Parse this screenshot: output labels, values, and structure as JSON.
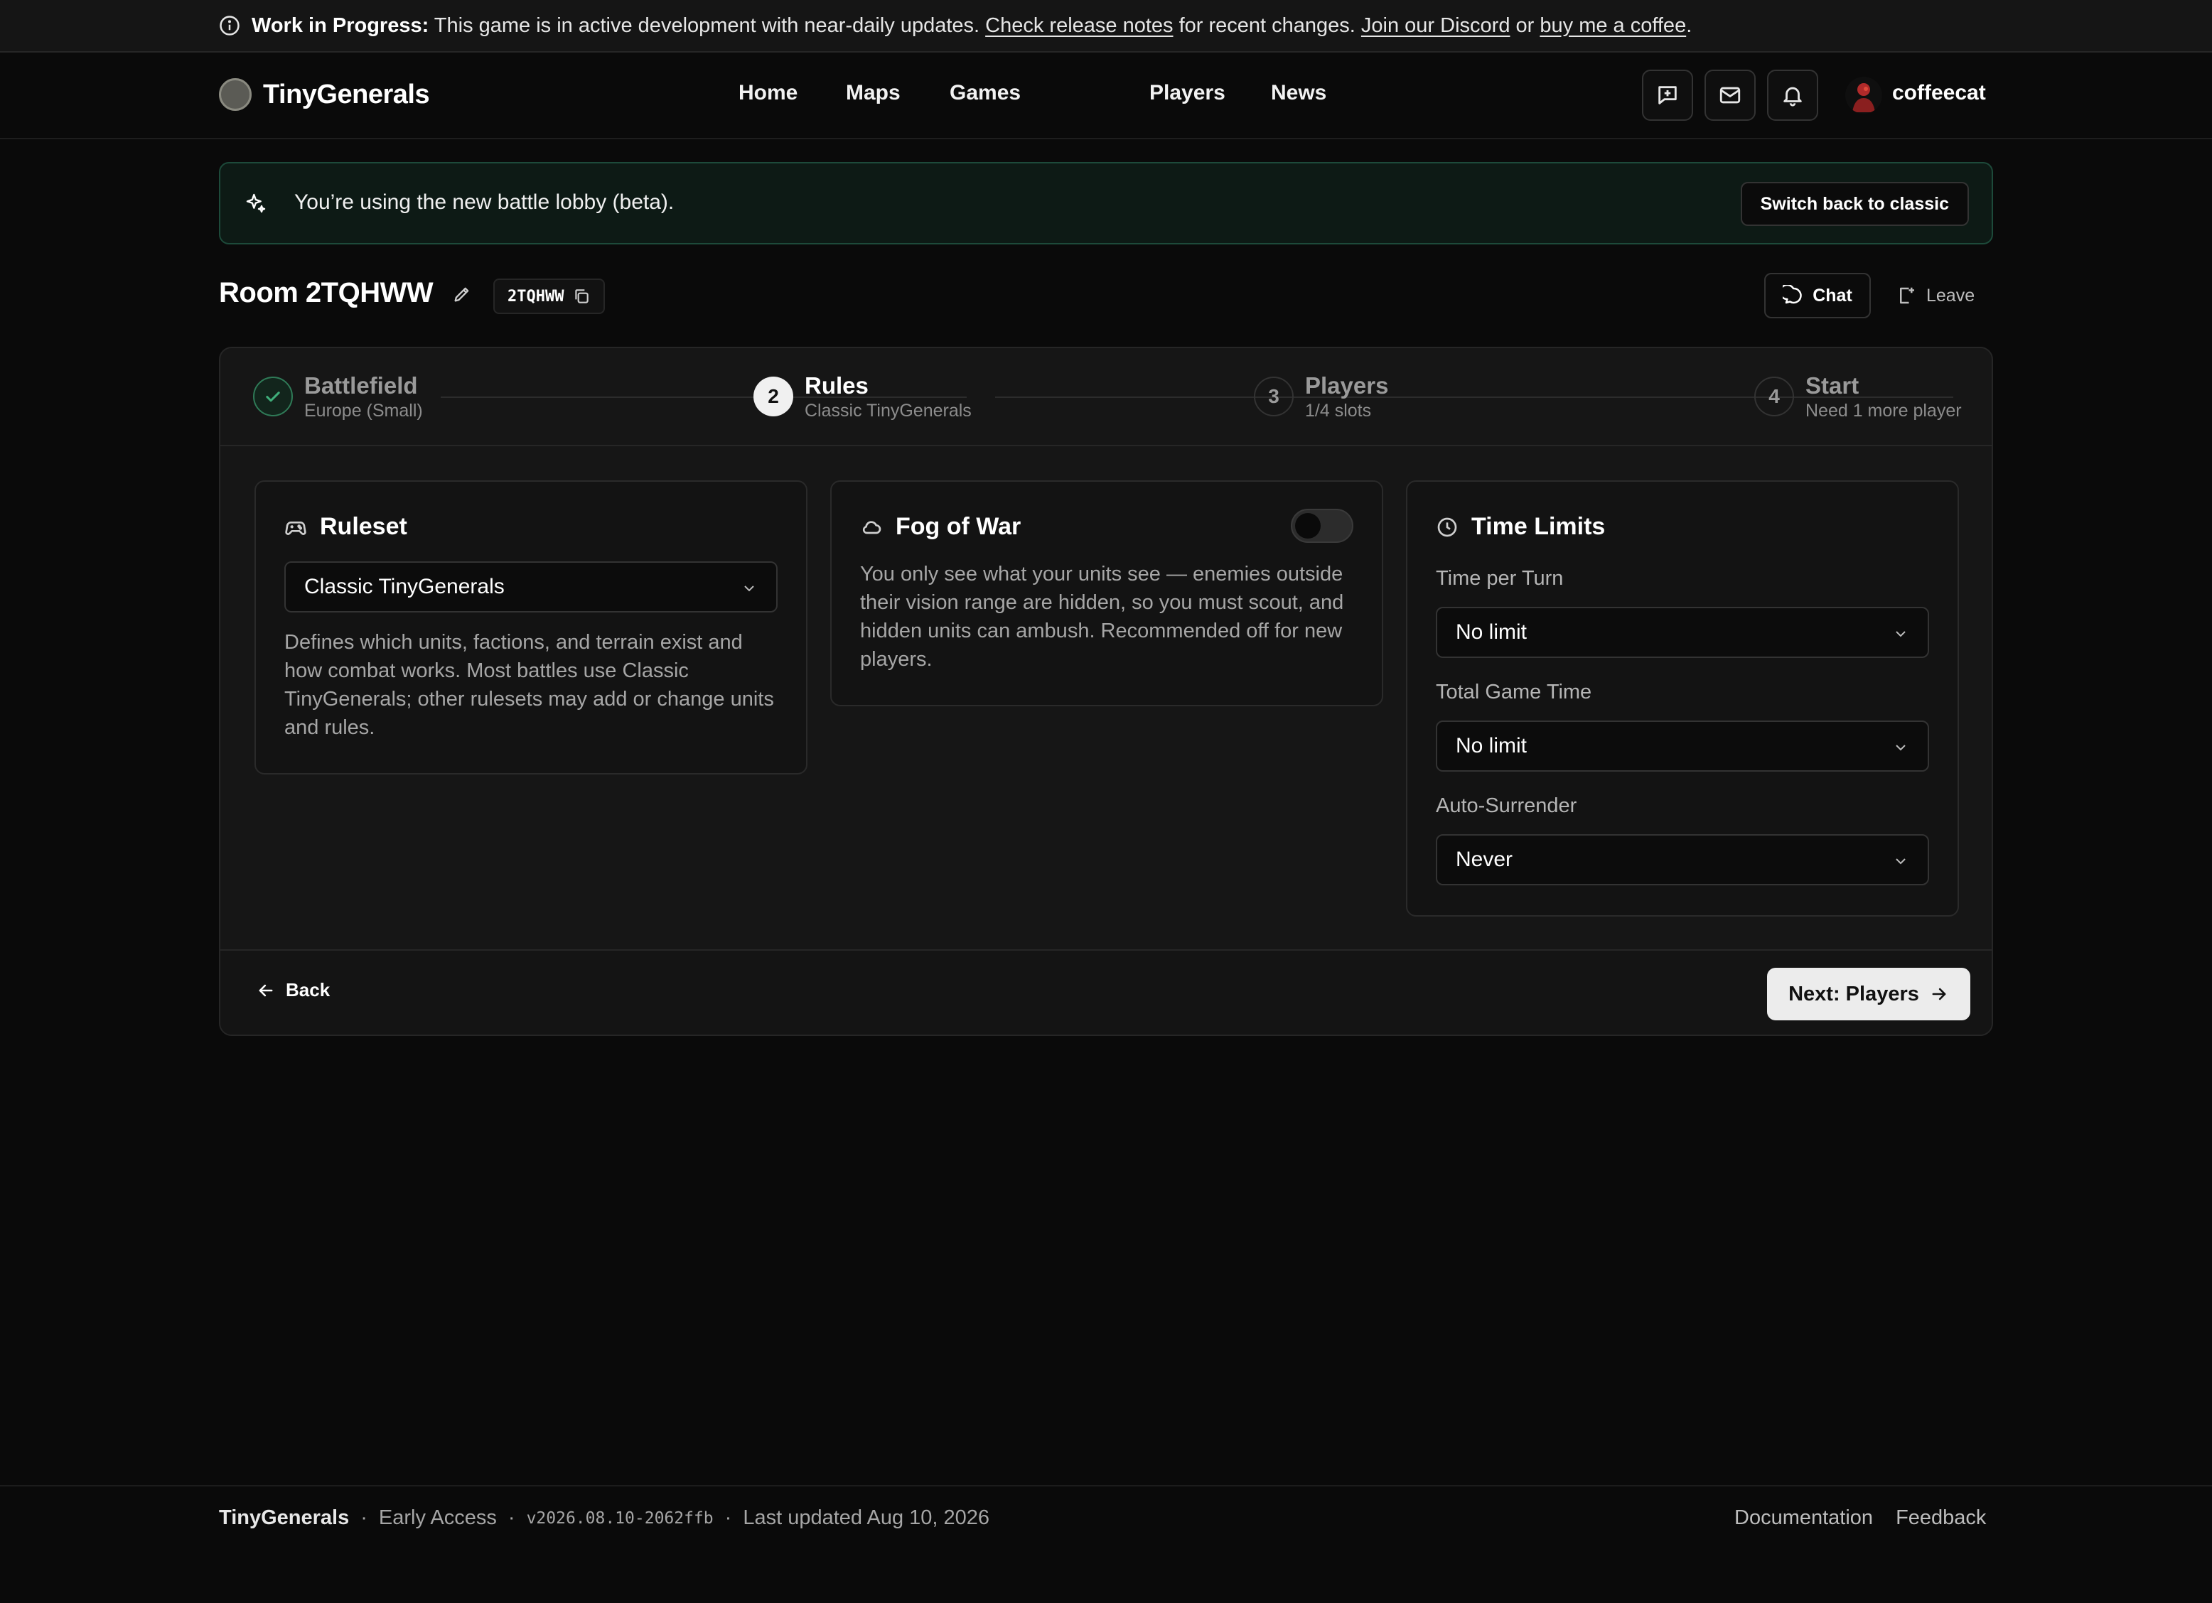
{
  "banner": {
    "title": "Work in Progress:",
    "message": "This game is in active development with near-daily updates.",
    "release_notes_link": "Check release notes",
    "after_release": "for recent changes.",
    "discord_link": "Join our Discord",
    "or": "or",
    "coffee_link": "buy me a coffee",
    "period": "."
  },
  "header": {
    "brand": "TinyGenerals",
    "nav": [
      "Home",
      "Maps",
      "Games",
      "Players",
      "News"
    ],
    "username": "coffeecat"
  },
  "beta_notice": {
    "text": "You’re using the new battle lobby (beta).",
    "button": "Switch back to classic"
  },
  "room": {
    "title": "Room 2TQHWW",
    "code": "2TQHWW",
    "chat_label": "Chat",
    "leave_label": "Leave"
  },
  "steps": [
    {
      "num": "",
      "title": "Battlefield",
      "subtitle": "Europe (Small)",
      "status": "complete"
    },
    {
      "num": "2",
      "title": "Rules",
      "subtitle": "Classic TinyGenerals",
      "status": "active"
    },
    {
      "num": "3",
      "title": "Players",
      "subtitle": "1/4 slots",
      "status": "pending"
    },
    {
      "num": "4",
      "title": "Start",
      "subtitle": "Need 1 more player",
      "status": "pending"
    }
  ],
  "ruleset": {
    "title": "Ruleset",
    "selected": "Classic TinyGenerals",
    "description": "Defines which units, factions, and terrain exist and how combat works. Most battles use Classic TinyGenerals; other rulesets may add or change units and rules."
  },
  "fog": {
    "title": "Fog of War",
    "enabled": false,
    "description": "You only see what your units see — enemies outside their vision range are hidden, so you must scout, and hidden units can ambush. Recommended off for new players."
  },
  "time_limits": {
    "title": "Time Limits",
    "fields": [
      {
        "label": "Time per Turn",
        "value": "No limit"
      },
      {
        "label": "Total Game Time",
        "value": "No limit"
      },
      {
        "label": "Auto-Surrender",
        "value": "Never"
      }
    ]
  },
  "actions": {
    "back": "Back",
    "next": "Next: Players"
  },
  "footer": {
    "brand": "TinyGenerals",
    "sep": "·",
    "stage": "Early Access",
    "version": "v2026.08.10-2062ffb",
    "updated": "Last updated Aug 10, 2026",
    "links": [
      "Documentation",
      "Feedback"
    ]
  },
  "colors": {
    "background": "#0a0a0a",
    "success": "#3fae7a",
    "beta_border": "#1d4a3a"
  }
}
